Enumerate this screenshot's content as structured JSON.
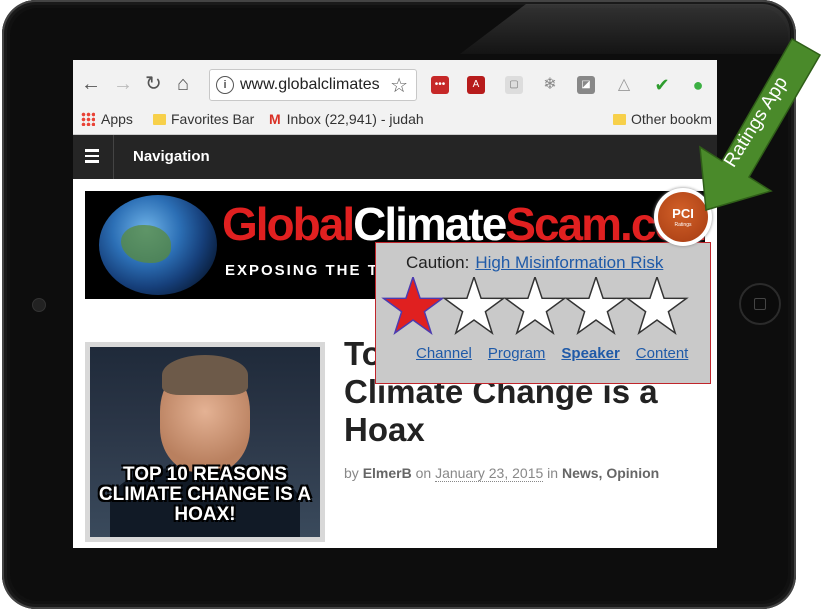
{
  "browser": {
    "url": "www.globalclimates",
    "bookmarks": [
      "Apps",
      "Favorites Bar",
      "Inbox (22,941) - judah",
      "Other bookm"
    ]
  },
  "site": {
    "nav_title": "Navigation",
    "banner_left": "Global",
    "banner_mid": "Climate",
    "banner_right": "Scam.com",
    "banner_sub": "EXPOSING THE TRU"
  },
  "article": {
    "image_caption": "TOP 10 REASONS CLIMATE CHANGE IS A HOAX!",
    "headline": "Top 10 Reasons Climate Change is a Hoax",
    "byline_by": "by",
    "author": "ElmerB",
    "byline_on": "on",
    "date": "January 23, 2015",
    "byline_in": "in",
    "cat1": "News",
    "cat2": "Opinion"
  },
  "popup": {
    "caution": "Caution:",
    "risk_link": "High Misinformation Risk",
    "rating": 1,
    "tabs": [
      "Channel",
      "Program",
      "Speaker",
      "Content"
    ],
    "active_tab": "Speaker",
    "badge": "PCI",
    "badge_sub": "Ratings"
  },
  "annotation": {
    "label": "Ratings App"
  },
  "colors": {
    "accent_red": "#e02020",
    "link_blue": "#1f5aa8",
    "arrow_green": "#4a8a2a",
    "badge_orange": "#c4501c"
  }
}
